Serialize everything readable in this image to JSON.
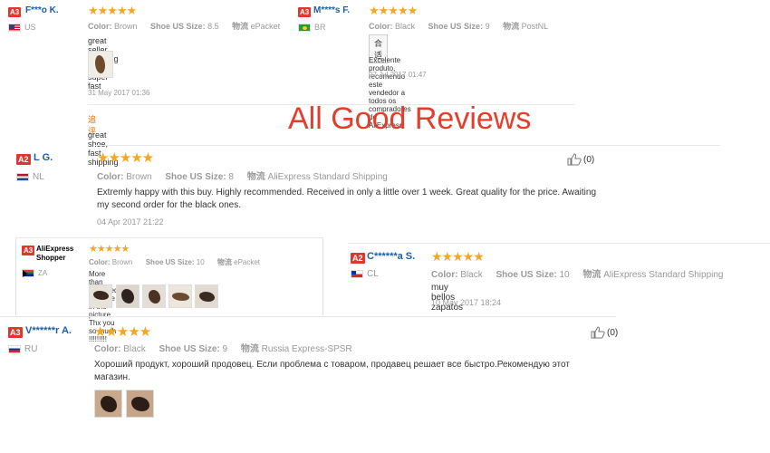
{
  "overlay_title": "All Good Reviews",
  "colors": {
    "badge": "#e0362c",
    "name": "#1a5ea8",
    "stars": "#f5a623",
    "title": "#e53d2c"
  },
  "stars_glyph": "★★★★★",
  "labels": {
    "color": "Color:",
    "size": "Shoe US Size:",
    "shipping": "物流"
  },
  "reviews": [
    {
      "level": "A3",
      "name": "F***o K.",
      "country": "US",
      "stars": 5,
      "color": "Brown",
      "size": "8.5",
      "shipping": "ePacket",
      "text": "great seller, shipping was super fast",
      "date": "31 May 2017 01:36",
      "followup_label": "追评",
      "followup_text": "great shoe, fast shipping"
    },
    {
      "level": "A3",
      "name": "M****s F.",
      "country": "BR",
      "stars": 5,
      "color": "Black",
      "size": "9",
      "shipping": "PostNL",
      "tag": "合适",
      "text": "Excelente produto, recomendo este vendedor a todos os compradores do AliExpress.",
      "date": "07 Jul 2017 01:47"
    },
    {
      "level": "A2",
      "name": "L G.",
      "country": "NL",
      "stars": 5,
      "color": "Brown",
      "size": "8",
      "shipping": "AliExpress Standard Shipping",
      "text": "Extremly happy with this buy. Highly recommended. Received in only a little over 1 week. Great quality for the price. Awaiting my second order for the black ones.",
      "date": "04 Apr 2017 21:22",
      "helpful": "(0)"
    },
    {
      "level": "A3",
      "name": "AliExpress Shopper",
      "country": "ZA",
      "stars": 5,
      "color": "Brown",
      "size": "10",
      "shipping": "ePacket",
      "text": "More than expected! Just like in the picture . Thx you so much !!!!!!!!!"
    },
    {
      "level": "A2",
      "name": "C******a S.",
      "country": "CL",
      "stars": 5,
      "color": "Black",
      "size": "10",
      "shipping": "AliExpress Standard Shipping",
      "text": "muy bellos zapatos",
      "date": "10 May 2017 18:24"
    },
    {
      "level": "A3",
      "name": "V******r A.",
      "country": "RU",
      "stars": 5,
      "color": "Black",
      "size": "9",
      "shipping": "Russia Express-SPSR",
      "text": "Хороший продукт, хороший продовец. Если проблема с товаром, продавец решает все быстро.Рекомендую этот магазин.",
      "helpful": "(0)"
    }
  ]
}
